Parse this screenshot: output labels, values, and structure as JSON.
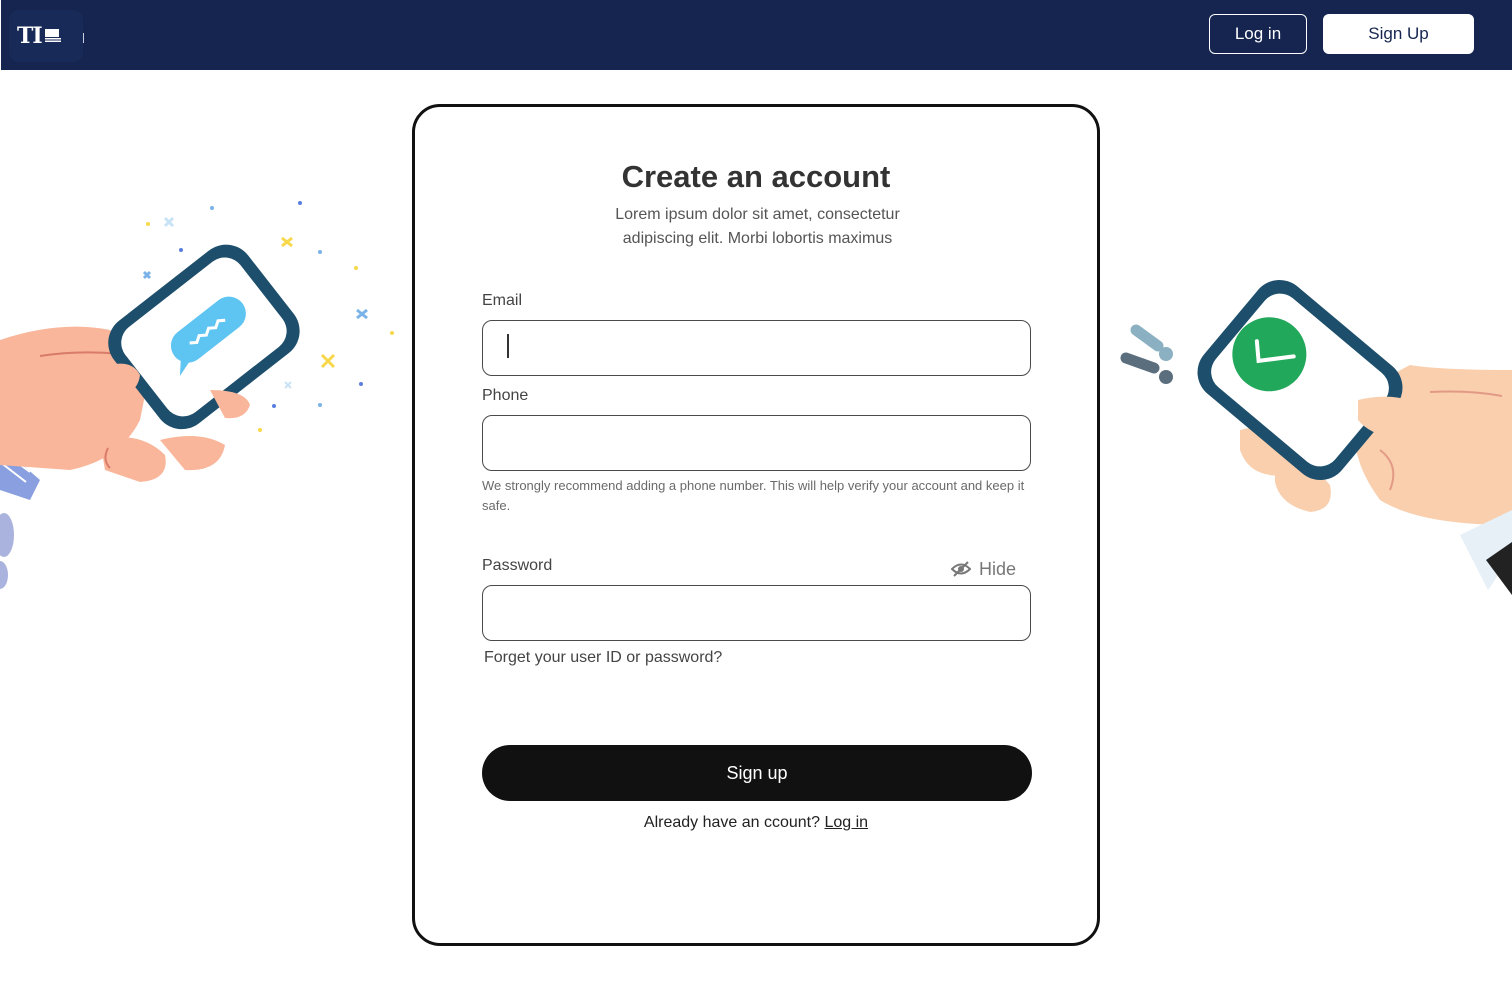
{
  "header": {
    "logo_text": "TI",
    "login_label": "Log in",
    "signup_label": "Sign Up"
  },
  "form": {
    "title": "Create an account",
    "subtitle": "Lorem ipsum dolor sit amet, consectetur adipiscing elit. Morbi lobortis maximus",
    "email_label": "Email",
    "email_value": "",
    "phone_label": "Phone",
    "phone_value": "",
    "phone_helper": "We strongly recommend adding a phone number. This will help verify your account and keep it safe.",
    "password_label": "Password",
    "password_value": "",
    "hide_label": "Hide",
    "forgot_label": "Forget your user ID or password?",
    "submit_label": "Sign up",
    "already_text": "Already have an ccount?",
    "already_link": "Log in"
  },
  "colors": {
    "header_bg": "#15254f",
    "button_dark": "#111111",
    "phone_frame": "#1d4e6b",
    "message_bubble": "#5ec4f2",
    "check_green": "#22a85a",
    "skin": "#f9b69a"
  }
}
